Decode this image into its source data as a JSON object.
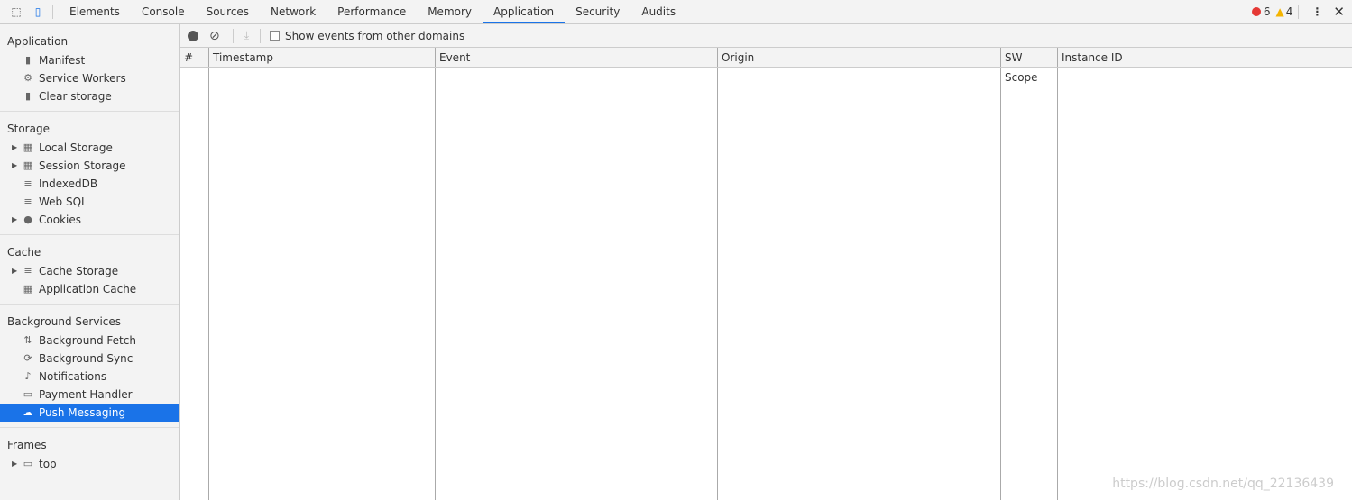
{
  "tabs": [
    "Elements",
    "Console",
    "Sources",
    "Network",
    "Performance",
    "Memory",
    "Application",
    "Security",
    "Audits"
  ],
  "active_tab": "Application",
  "errors": "6",
  "warnings": "4",
  "sidebar": {
    "sections": [
      {
        "title": "Application",
        "items": [
          {
            "label": "Manifest",
            "icon": "file-icon"
          },
          {
            "label": "Service Workers",
            "icon": "gear-icon"
          },
          {
            "label": "Clear storage",
            "icon": "trash-icon"
          }
        ]
      },
      {
        "title": "Storage",
        "items": [
          {
            "label": "Local Storage",
            "icon": "grid-icon",
            "expand": true
          },
          {
            "label": "Session Storage",
            "icon": "grid-icon",
            "expand": true
          },
          {
            "label": "IndexedDB",
            "icon": "database-icon"
          },
          {
            "label": "Web SQL",
            "icon": "database-icon"
          },
          {
            "label": "Cookies",
            "icon": "cookie-icon",
            "expand": true
          }
        ]
      },
      {
        "title": "Cache",
        "items": [
          {
            "label": "Cache Storage",
            "icon": "database-icon",
            "expand": true
          },
          {
            "label": "Application Cache",
            "icon": "grid-icon"
          }
        ]
      },
      {
        "title": "Background Services",
        "items": [
          {
            "label": "Background Fetch",
            "icon": "arrows-icon"
          },
          {
            "label": "Background Sync",
            "icon": "sync-icon"
          },
          {
            "label": "Notifications",
            "icon": "bell-icon"
          },
          {
            "label": "Payment Handler",
            "icon": "card-icon"
          },
          {
            "label": "Push Messaging",
            "icon": "cloud-icon",
            "selected": true
          }
        ]
      },
      {
        "title": "Frames",
        "items": [
          {
            "label": "top",
            "icon": "frame-icon",
            "expand": true
          }
        ]
      }
    ]
  },
  "toolbar": {
    "checkbox_label": "Show events from other domains"
  },
  "table": {
    "columns": [
      "#",
      "Timestamp",
      "Event",
      "Origin",
      "SW Scope",
      "Instance ID"
    ]
  },
  "watermark": "https://blog.csdn.net/qq_22136439"
}
